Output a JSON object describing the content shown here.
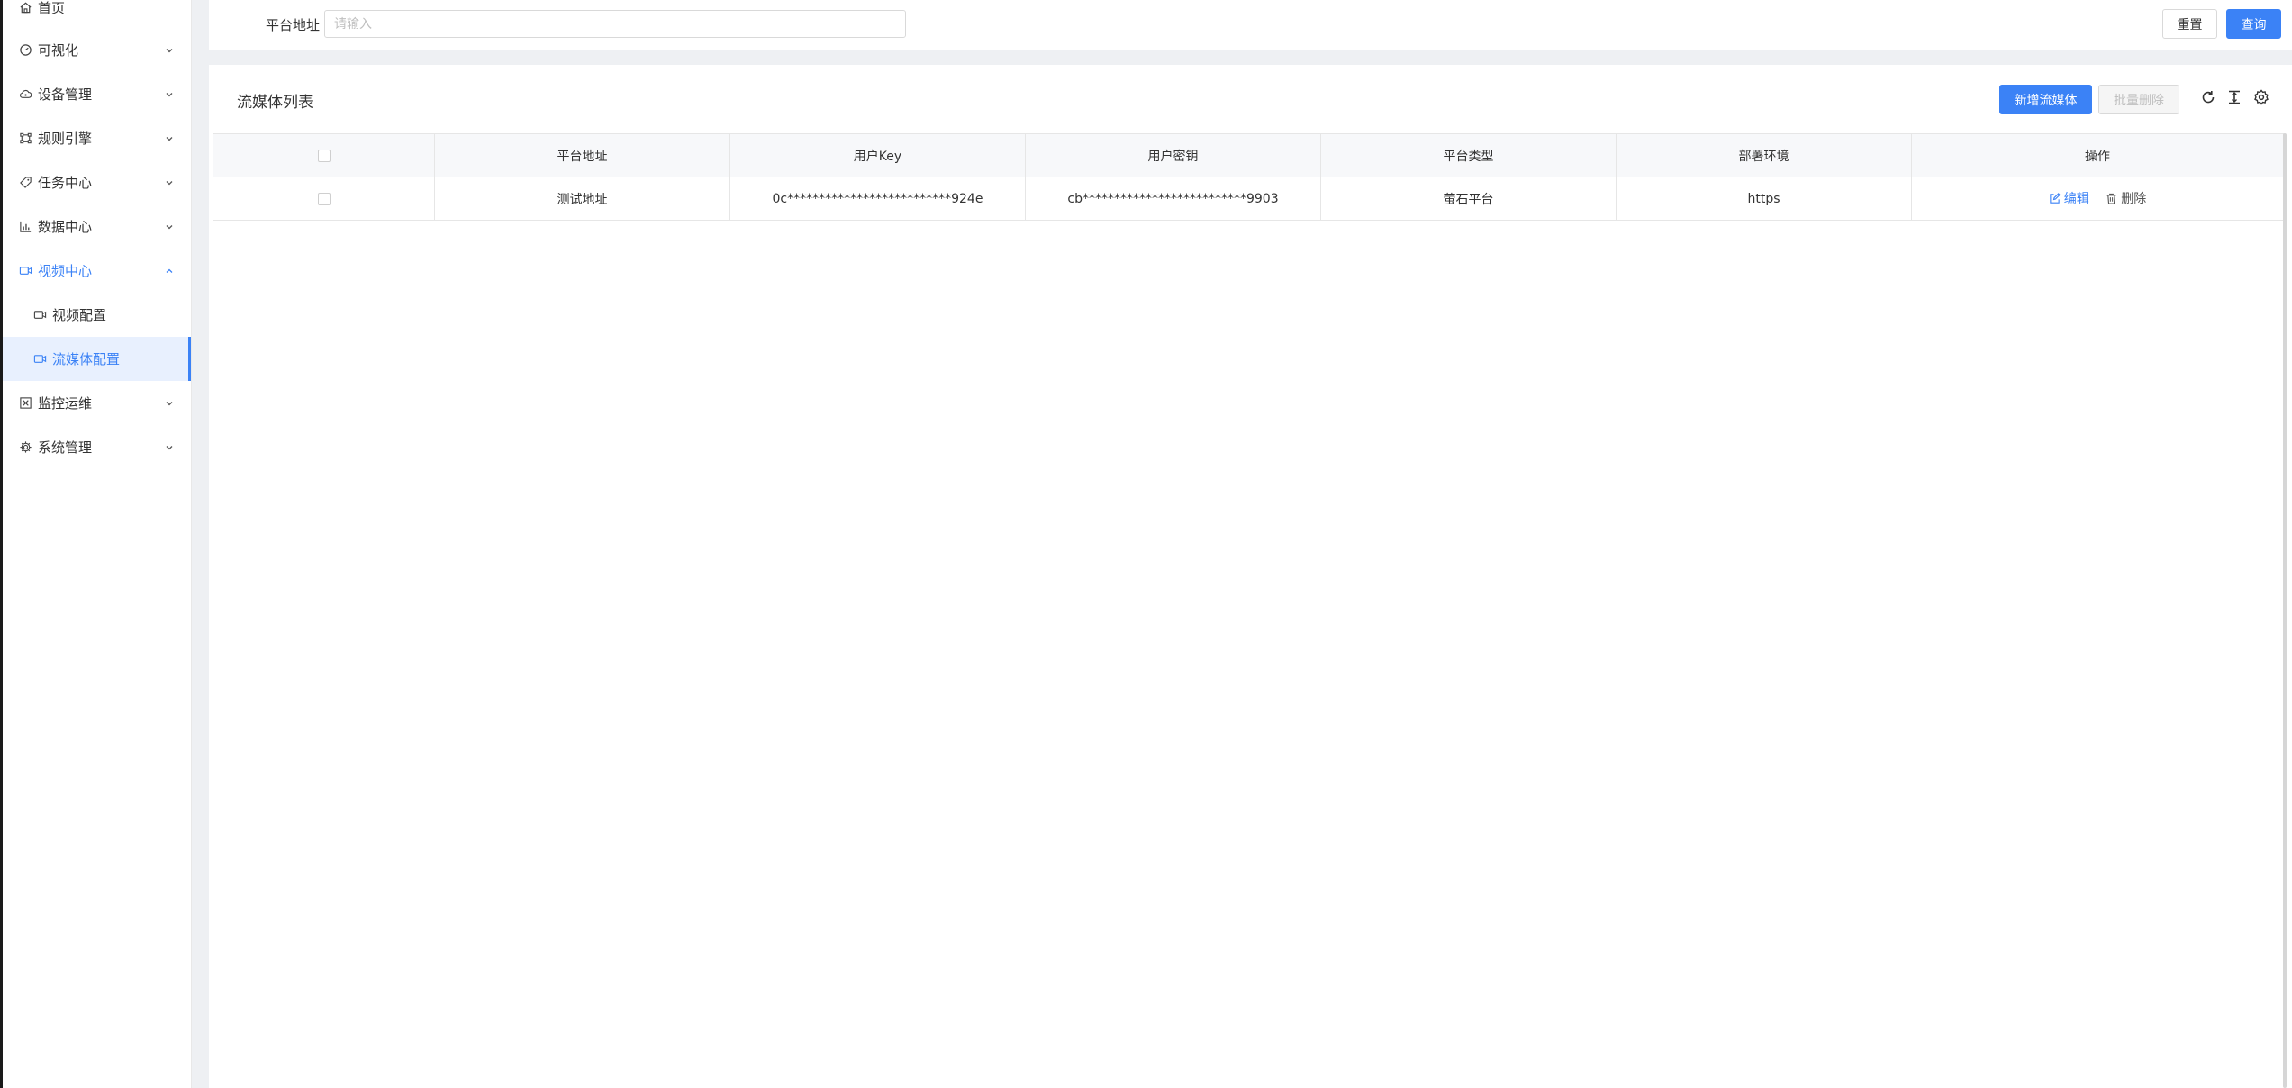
{
  "sidebar": {
    "items": [
      {
        "label": "首页",
        "icon": "home-icon"
      },
      {
        "label": "可视化",
        "icon": "gauge-icon"
      },
      {
        "label": "设备管理",
        "icon": "cloud-device-icon"
      },
      {
        "label": "规则引擎",
        "icon": "rule-engine-icon"
      },
      {
        "label": "任务中心",
        "icon": "tag-icon"
      },
      {
        "label": "数据中心",
        "icon": "bar-chart-icon"
      },
      {
        "label": "视频中心",
        "icon": "video-icon"
      },
      {
        "label": "监控运维",
        "icon": "monitor-icon"
      },
      {
        "label": "系统管理",
        "icon": "gear-icon"
      }
    ],
    "sub_items": [
      {
        "label": "视频配置",
        "icon": "video-config-icon"
      },
      {
        "label": "流媒体配置",
        "icon": "stream-config-icon"
      }
    ],
    "active_color": "#3b82f6"
  },
  "search": {
    "label": "平台地址",
    "placeholder": "请输入",
    "reset_label": "重置",
    "query_label": "查询"
  },
  "list": {
    "title": "流媒体列表",
    "add_label": "新增流媒体",
    "batch_delete_label": "批量删除",
    "columns": [
      "平台地址",
      "用户Key",
      "用户密钥",
      "平台类型",
      "部署环境",
      "操作"
    ],
    "rows": [
      {
        "address": "测试地址",
        "key": "0c**************************924e",
        "secret": "cb**************************9903",
        "type": "萤石平台",
        "env": "https",
        "edit_label": "编辑",
        "delete_label": "删除"
      }
    ]
  }
}
